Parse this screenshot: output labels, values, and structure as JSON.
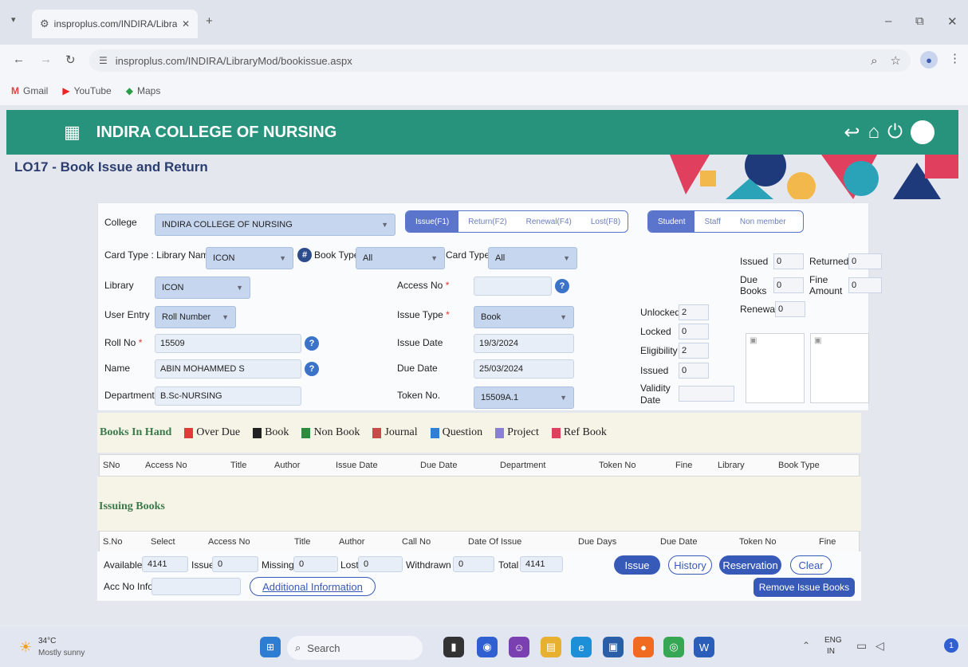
{
  "browser": {
    "tab_title": "insproplus.com/INDIRA/Library",
    "url": "insproplus.com/INDIRA/LibraryMod/bookissue.aspx",
    "bookmarks": [
      "Gmail",
      "YouTube",
      "Maps"
    ]
  },
  "header": {
    "title": "INDIRA COLLEGE OF NURSING"
  },
  "page_title": "LO17 - Book Issue and Return",
  "form": {
    "college_label": "College",
    "college_value": "INDIRA COLLEGE OF NURSING",
    "mode_tabs": [
      "Issue(F1)",
      "Return(F2)",
      "Renewal(F4)",
      "Lost(F8)"
    ],
    "member_tabs": [
      "Student",
      "Staff",
      "Non member"
    ],
    "card_type_library_label": "Card Type : Library Name",
    "card_type_library_value": "ICON",
    "book_type_label": "Book Type",
    "book_type_value": "All",
    "card_type_label": "Card Type",
    "card_type_value": "All",
    "library_label": "Library",
    "library_value": "ICON",
    "access_no_label": "Access No",
    "user_entry_label": "User Entry",
    "user_entry_value": "Roll Number",
    "issue_type_label": "Issue Type",
    "issue_type_value": "Book",
    "roll_no_label": "Roll No",
    "roll_no_value": "15509",
    "issue_date_label": "Issue Date",
    "issue_date_value": "19/3/2024",
    "name_label": "Name",
    "name_value": "ABIN MOHAMMED S",
    "due_date_label": "Due Date",
    "due_date_value": "25/03/2024",
    "department_label": "Department",
    "department_value": "B.Sc-NURSING",
    "token_no_label": "Token No.",
    "token_no_value": "15509A.1",
    "unlocked_label": "Unlocked",
    "unlocked_value": "2",
    "locked_label": "Locked",
    "locked_value": "0",
    "eligibility_label": "Eligibility",
    "eligibility_value": "2",
    "issued_mid_label": "Issued",
    "issued_mid_value": "0",
    "validity_label": "Validity Date",
    "issued_label": "Issued",
    "issued_value": "0",
    "returned_label": "Returned",
    "returned_value": "0",
    "due_books_label": "Due Books",
    "due_books_value": "0",
    "fine_amount_label": "Fine Amount",
    "fine_amount_value": "0",
    "renewal_label": "Renewal",
    "renewal_value": "0"
  },
  "legend": {
    "title": "Books In Hand",
    "items": [
      {
        "label": "Over Due",
        "color": "#e03b3b"
      },
      {
        "label": "Book",
        "color": "#222222"
      },
      {
        "label": "Non Book",
        "color": "#2e8b3e"
      },
      {
        "label": "Journal",
        "color": "#c94a4a"
      },
      {
        "label": "Question",
        "color": "#2f7fd8"
      },
      {
        "label": "Project",
        "color": "#8a7fd6"
      },
      {
        "label": "Ref Book",
        "color": "#e0405e"
      }
    ]
  },
  "books_in_hand_columns": [
    "SNo",
    "Access No",
    "Title",
    "Author",
    "Issue Date",
    "Due Date",
    "Department",
    "Token No",
    "Fine",
    "Library",
    "Book Type"
  ],
  "issuing_title": "Issuing Books",
  "issuing_columns": [
    "S.No",
    "Select",
    "Access No",
    "Title",
    "Author",
    "Call No",
    "Date Of Issue",
    "Due Days",
    "Due Date",
    "Token No",
    "Fine"
  ],
  "stats": {
    "available_label": "Available",
    "available_value": "4141",
    "issue_label": "Issue",
    "issue_value": "0",
    "missing_label": "Missing",
    "missing_value": "0",
    "lost_label": "Lost",
    "lost_value": "0",
    "withdrawn_label": "Withdrawn",
    "withdrawn_value": "0",
    "total_label": "Total",
    "total_value": "4141"
  },
  "buttons": {
    "issue": "Issue",
    "history": "History",
    "reservation": "Reservation",
    "clear": "Clear",
    "remove_issue_books": "Remove Issue Books",
    "additional_information": "Additional Information"
  },
  "acc_no_info_label": "Acc No Info",
  "taskbar": {
    "weather_temp": "34°C",
    "weather_desc": "Mostly sunny",
    "search_placeholder": "Search",
    "lang_top": "ENG",
    "lang_bottom": "IN"
  }
}
